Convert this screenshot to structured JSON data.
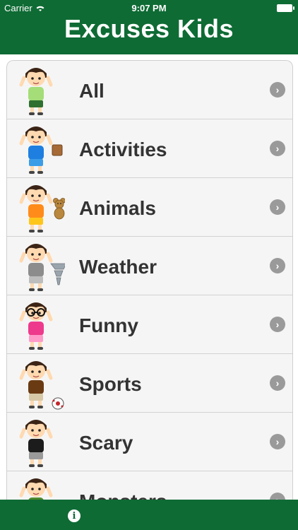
{
  "status_bar": {
    "carrier": "Carrier",
    "time": "9:07 PM"
  },
  "header": {
    "title": "Excuses Kids"
  },
  "categories": [
    {
      "label": "All",
      "shirt": "#a5dd78",
      "pants": "#2f6f2f",
      "prop": ""
    },
    {
      "label": "Activities",
      "shirt": "#1f7fe0",
      "pants": "#3b9de8",
      "prop": "book"
    },
    {
      "label": "Animals",
      "shirt": "#ff8c1a",
      "pants": "#ffc61a",
      "prop": "teddy"
    },
    {
      "label": "Weather",
      "shirt": "#8c8c8c",
      "pants": "#bdbdbd",
      "prop": "tornado"
    },
    {
      "label": "Funny",
      "shirt": "#ee3a8c",
      "pants": "#ff9ac9",
      "prop": "glasses"
    },
    {
      "label": "Sports",
      "shirt": "#6a3b13",
      "pants": "#d8c9a6",
      "prop": "ball"
    },
    {
      "label": "Scary",
      "shirt": "#1c1c1c",
      "pants": "#9a9a9a",
      "prop": ""
    },
    {
      "label": "Monsters",
      "shirt": "#4d8a2e",
      "pants": "#2f5f1f",
      "prop": ""
    }
  ],
  "footer": {
    "info_glyph": "i"
  }
}
